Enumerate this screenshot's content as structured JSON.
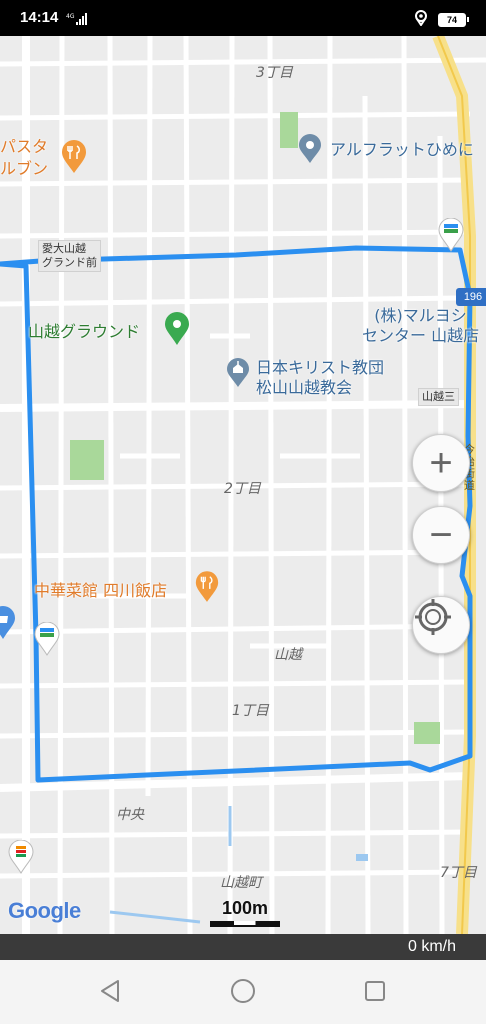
{
  "status_bar": {
    "time": "14:14",
    "signal": "4G",
    "battery": "74",
    "location_icon": "location-pin-icon"
  },
  "map": {
    "area_labels": {
      "chome3": "3丁目",
      "chome2": "2丁目",
      "yamagoe": "山越",
      "chome1": "1丁目",
      "chuo": "中央",
      "yamagoe_machi": "山越町",
      "chome7": "7丁目"
    },
    "pois": {
      "pasta_line1": "パスタ",
      "pasta_line2": "ルブン",
      "alflat": "アルフラットひめに",
      "yamagoe_ground": "山越グラウンド",
      "church_line1": "日本キリスト教団",
      "church_line2": "松山山越教会",
      "maruyoshi_line1": "(株)マルヨシ",
      "maruyoshi_line2": "センター 山越店",
      "chuka_line": "中華菜館 四川飯店"
    },
    "stops": {
      "aidai_line1": "愛大山越",
      "aidai_line2": "グランド前",
      "yamagoe3": "山越三"
    },
    "route_number": "196",
    "road_name": "今治街道",
    "route_color": "#2b8ff0"
  },
  "controls": {
    "zoom_in": "+",
    "zoom_out": "−"
  },
  "attribution": {
    "google": "Google",
    "scale": "100m"
  },
  "speed": "0 km/h"
}
